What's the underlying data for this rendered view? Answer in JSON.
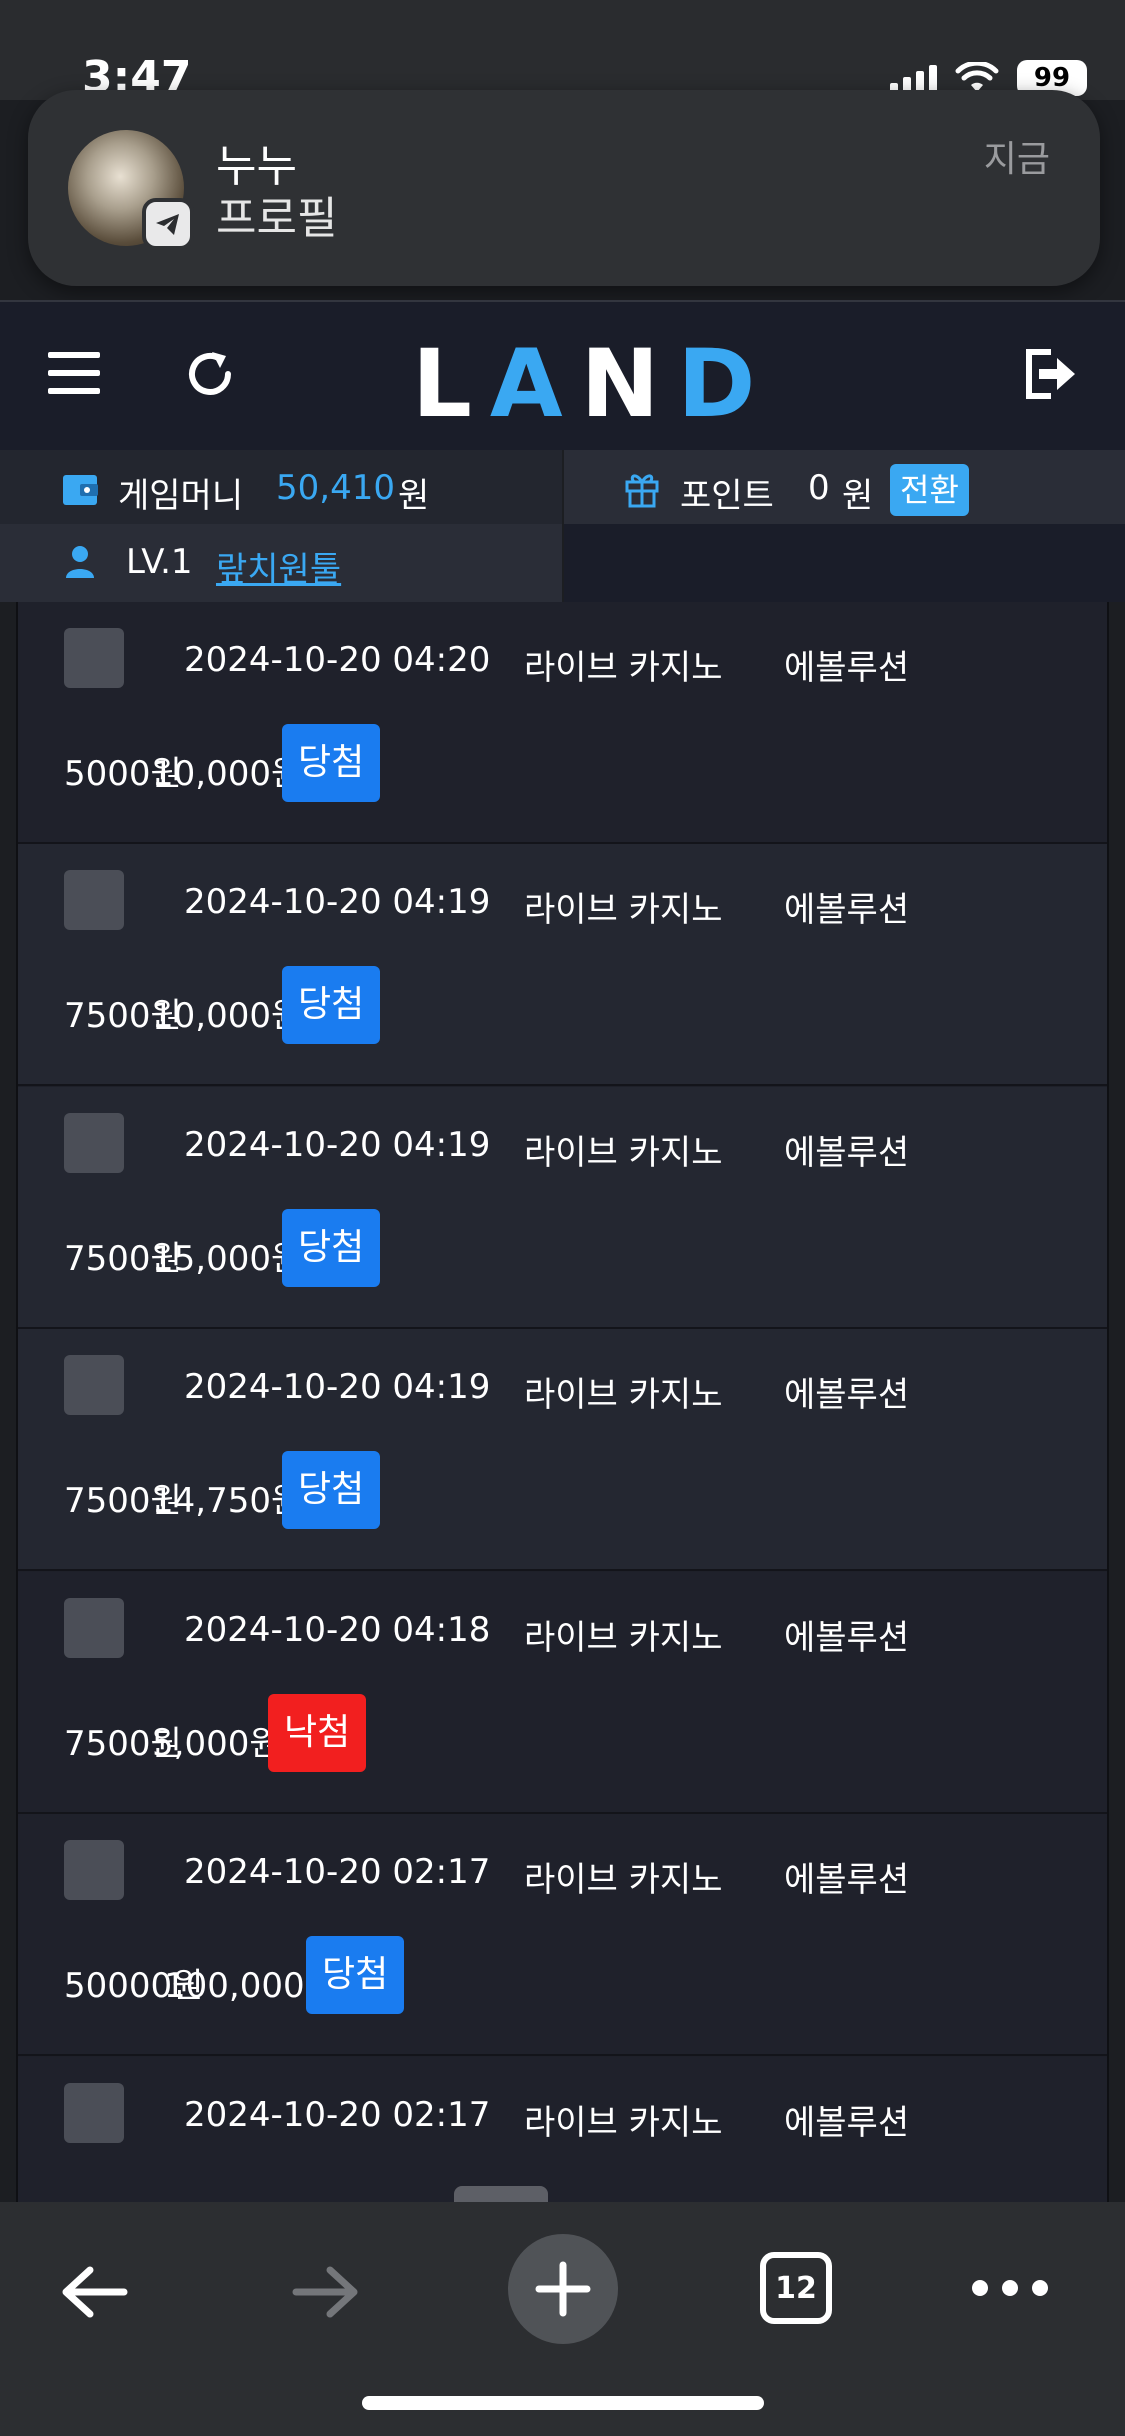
{
  "status_bar": {
    "time": "3:47",
    "battery": "99"
  },
  "notification": {
    "title": "누누",
    "subtitle": "프로필",
    "time": "지금"
  },
  "header": {
    "logo": "LAND"
  },
  "wallet": {
    "game_money_label": "게임머니",
    "game_money_value": "50,410",
    "game_money_unit": "원",
    "points_label": "포인트",
    "points_value": "0",
    "points_unit": "원",
    "convert_label": "전환",
    "level": "LV.1",
    "username": "랖치원툴"
  },
  "bets": [
    {
      "date": "2024-10-20 04:20",
      "game": "라이브 카지노",
      "provider": "에볼루션",
      "bet": "5000원",
      "win": "10,000원",
      "result": "당첨"
    },
    {
      "date": "2024-10-20 04:19",
      "game": "라이브 카지노",
      "provider": "에볼루션",
      "bet": "7500원",
      "win": "10,000원",
      "result": "당첨"
    },
    {
      "date": "2024-10-20 04:19",
      "game": "라이브 카지노",
      "provider": "에볼루션",
      "bet": "7500원",
      "win": "15,000원",
      "result": "당첨"
    },
    {
      "date": "2024-10-20 04:19",
      "game": "라이브 카지노",
      "provider": "에볼루션",
      "bet": "7500원",
      "win": "14,750원",
      "result": "당첨"
    },
    {
      "date": "2024-10-20 04:18",
      "game": "라이브 카지노",
      "provider": "에볼루션",
      "bet": "7500원",
      "win": "5,000원",
      "result": "낙첨"
    },
    {
      "date": "2024-10-20 02:17",
      "game": "라이브 카지노",
      "provider": "에볼루션",
      "bet": "50000원",
      "win": "100,000원",
      "result": "당첨"
    },
    {
      "date": "2024-10-20 02:17",
      "game": "라이브 카지노",
      "provider": "에볼루션",
      "bet": "",
      "win": "",
      "result": ""
    }
  ],
  "toolbar": {
    "tab_count": "12"
  }
}
